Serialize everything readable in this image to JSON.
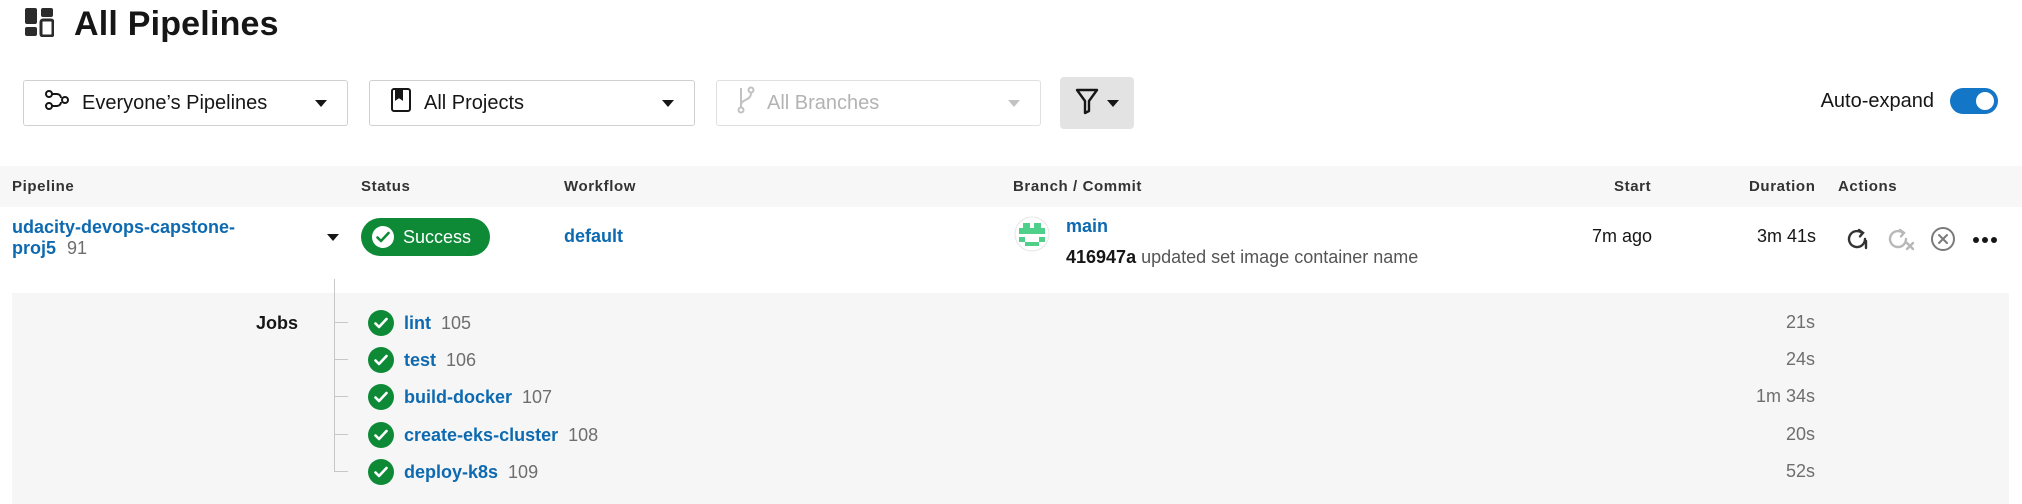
{
  "header": {
    "title": "All Pipelines",
    "icon": "dashboard-icon"
  },
  "filters": {
    "pipelines": "Everyone’s Pipelines",
    "projects": "All Projects",
    "branches": "All Branches",
    "auto_expand_label": "Auto-expand",
    "auto_expand_on": true
  },
  "table": {
    "headers": {
      "pipeline": "Pipeline",
      "status": "Status",
      "workflow": "Workflow",
      "branch_commit": "Branch / Commit",
      "start": "Start",
      "duration": "Duration",
      "actions": "Actions"
    },
    "row": {
      "name_line1": "udacity-devops-capstone-",
      "name_line2": "proj5",
      "number": "91",
      "status": "Success",
      "workflow": "default",
      "branch": "main",
      "commit_hash": "416947a",
      "commit_message": "updated set image container name",
      "start": "7m ago",
      "duration": "3m 41s"
    },
    "jobs_label": "Jobs",
    "jobs": [
      {
        "name": "lint",
        "number": "105",
        "duration": "21s"
      },
      {
        "name": "test",
        "number": "106",
        "duration": "24s"
      },
      {
        "name": "build-docker",
        "number": "107",
        "duration": "1m 34s"
      },
      {
        "name": "create-eks-cluster",
        "number": "108",
        "duration": "20s"
      },
      {
        "name": "deploy-k8s",
        "number": "109",
        "duration": "52s"
      }
    ]
  },
  "colors": {
    "success": "#0e8a37",
    "link": "#0e6ab0",
    "toggle": "#1476c6"
  }
}
